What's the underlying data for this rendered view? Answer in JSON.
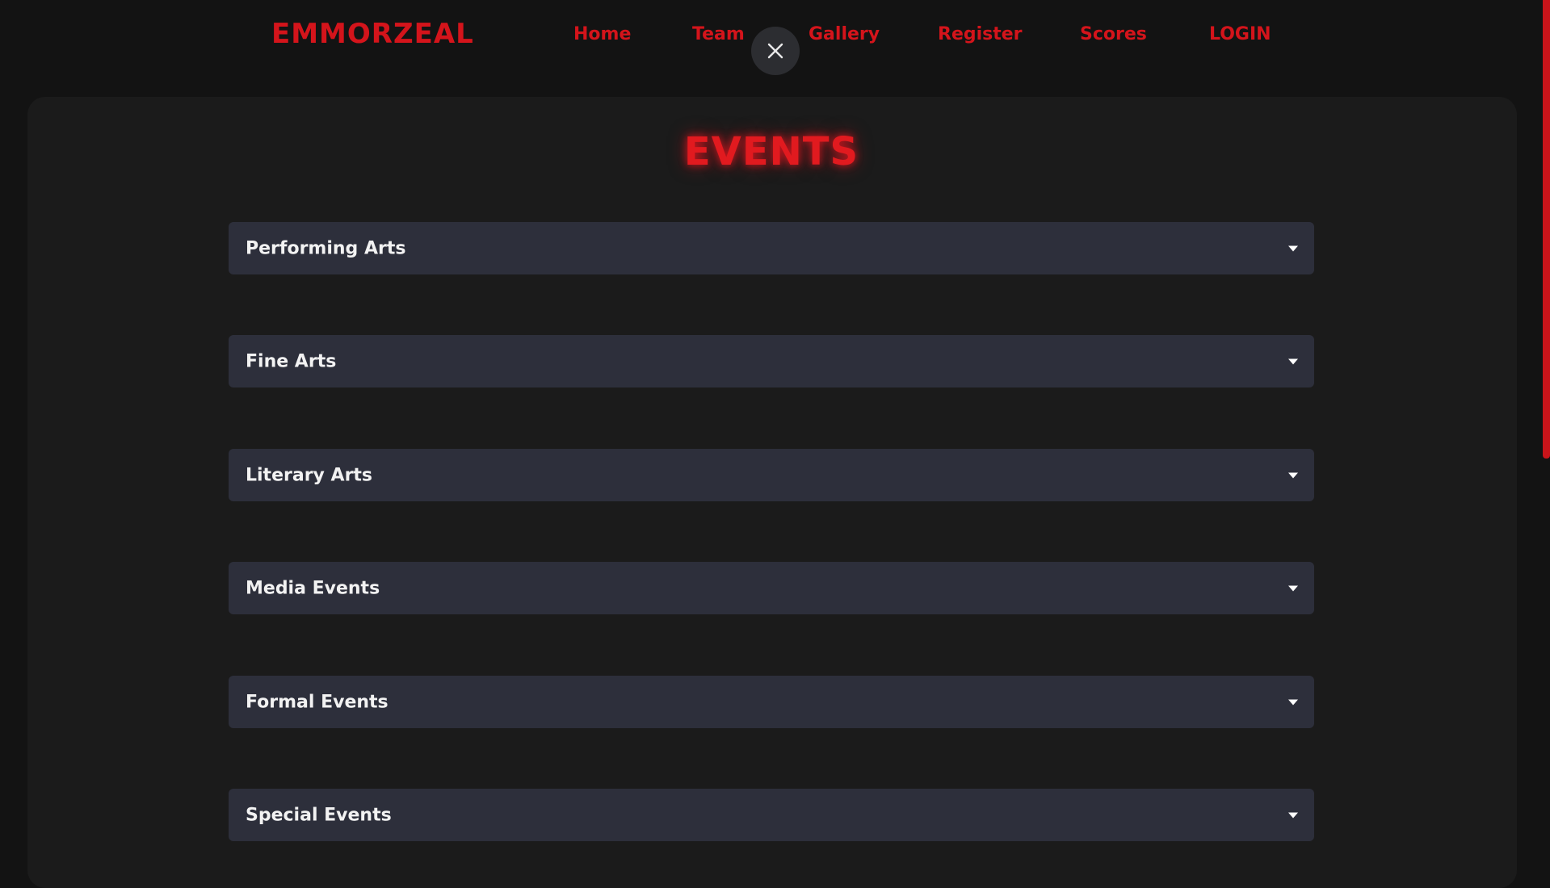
{
  "header": {
    "brand": "EMMORZEAL",
    "nav": [
      {
        "label": "Home"
      },
      {
        "label": "Team"
      },
      {
        "label": "Gallery"
      },
      {
        "label": "Register"
      },
      {
        "label": "Scores"
      },
      {
        "label": "LOGIN"
      }
    ],
    "close_icon": "close-icon"
  },
  "main": {
    "title": "EVENTS",
    "categories": [
      {
        "label": "Performing Arts",
        "icon": "chevron-down-icon"
      },
      {
        "label": "Fine Arts",
        "icon": "chevron-down-icon"
      },
      {
        "label": "Literary Arts",
        "icon": "chevron-down-icon"
      },
      {
        "label": "Media Events",
        "icon": "chevron-down-icon"
      },
      {
        "label": "Formal Events",
        "icon": "chevron-down-icon"
      },
      {
        "label": "Special Events",
        "icon": "chevron-down-icon"
      }
    ]
  },
  "colors": {
    "accent": "#d4141b",
    "background": "#131313",
    "panel": "#1b1b1b",
    "accordion": "#2d2f3b",
    "text": "#f2f2f2"
  }
}
